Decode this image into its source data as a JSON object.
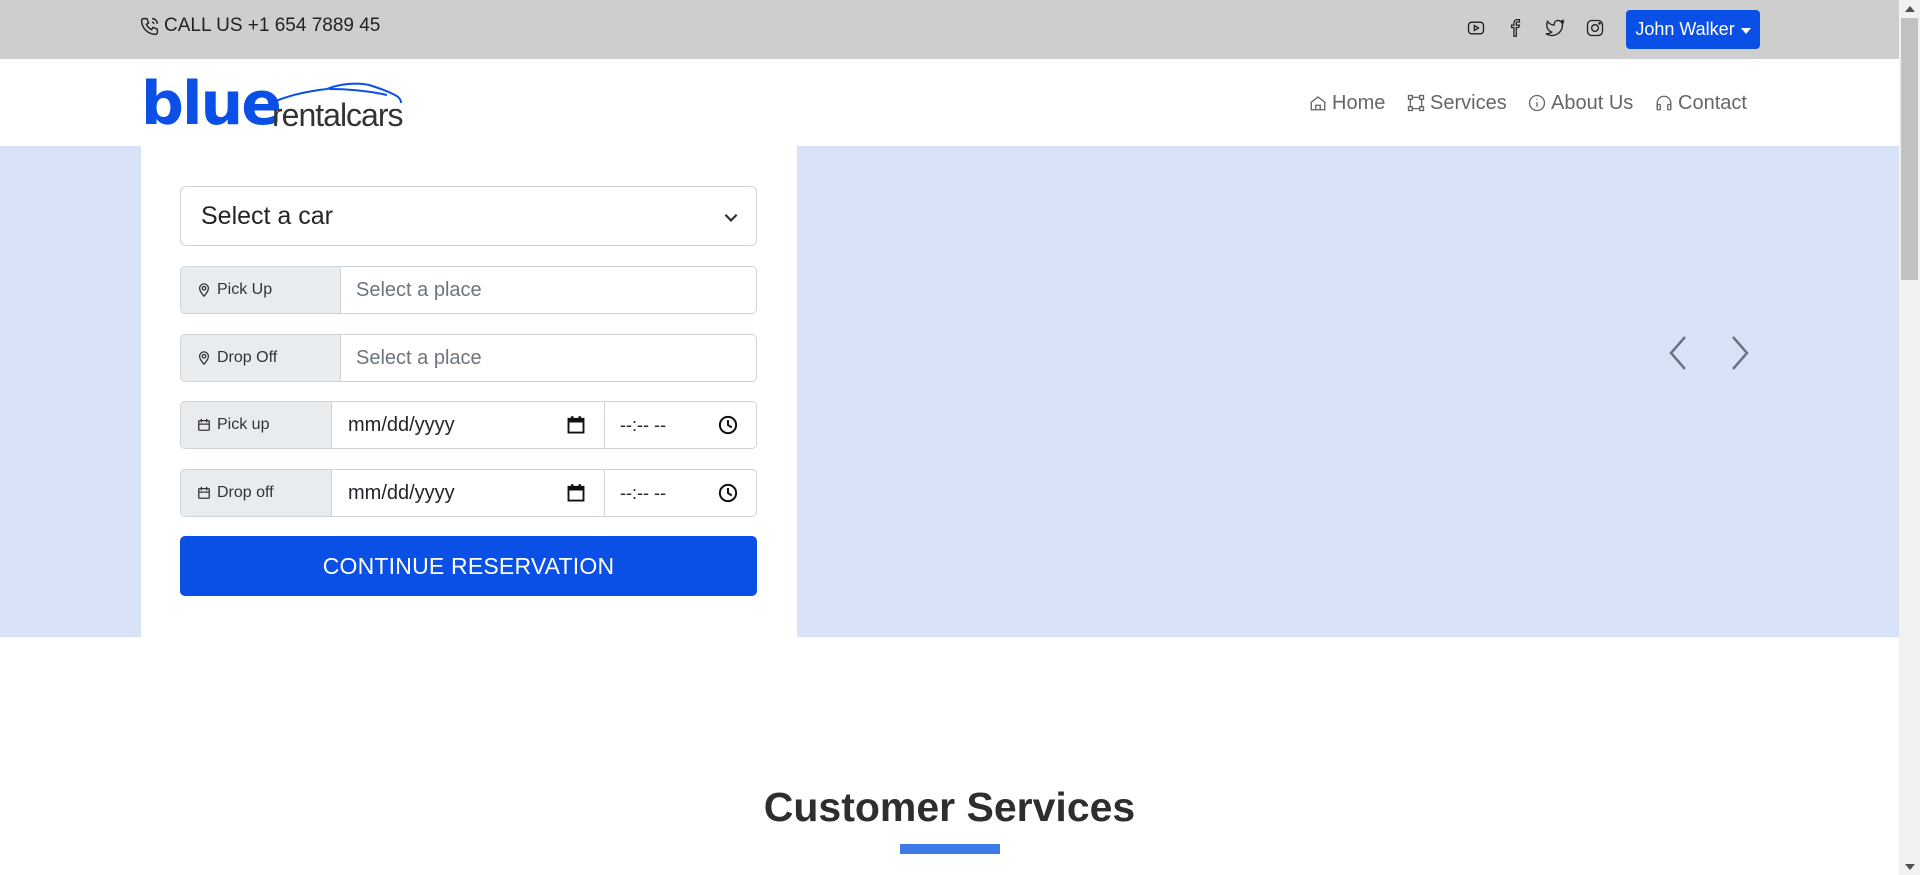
{
  "topbar": {
    "call_text": "CALL US +1 654 7889 45",
    "social_icons": [
      "youtube-icon",
      "facebook-icon",
      "twitter-icon",
      "instagram-icon"
    ],
    "user_button": "John Walker"
  },
  "brand": {
    "logo_primary": "blue",
    "logo_secondary": "rentalcars",
    "accent_color": "#0a4fe6"
  },
  "nav": {
    "items": [
      {
        "label": "Home",
        "icon": "home-icon"
      },
      {
        "label": "Services",
        "icon": "services-icon"
      },
      {
        "label": "About Us",
        "icon": "info-icon"
      },
      {
        "label": "Contact",
        "icon": "headphones-icon"
      }
    ]
  },
  "form": {
    "car_select": "Select a car",
    "pickup_place": {
      "label": "Pick Up",
      "placeholder": "Select a place"
    },
    "dropoff_place": {
      "label": "Drop Off",
      "placeholder": "Select a place"
    },
    "pickup_datetime": {
      "label": "Pick up",
      "date": "mm/dd/yyyy",
      "time": "--:-- --"
    },
    "dropoff_datetime": {
      "label": "Drop off",
      "date": "mm/dd/yyyy",
      "time": "--:-- --"
    },
    "submit": "CONTINUE RESERVATION"
  },
  "hero": {
    "background_color": "#d9e3f8"
  },
  "section": {
    "title": "Customer Services",
    "underline_color": "#3d7ae5"
  }
}
